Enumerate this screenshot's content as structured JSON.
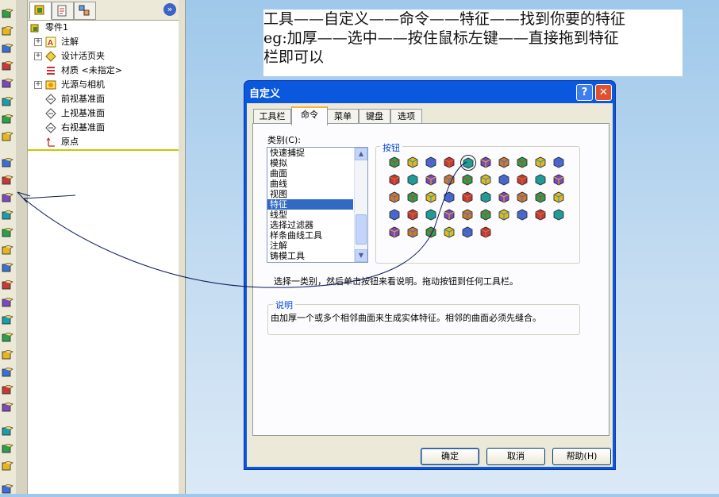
{
  "left_toolbar": {
    "icons": [
      "extrude-icon",
      "revolve-icon",
      "sweep-icon",
      "loft-icon",
      "fillet-icon",
      "chamfer-icon",
      "shell-icon",
      "draft-icon",
      "rib-icon",
      "hole-icon",
      "mirror-icon",
      "pattern-icon",
      "dome-icon",
      "wrap-icon",
      "scale-icon",
      "split-icon",
      "combine-icon",
      "thicken-icon",
      "move-face-icon",
      "freeform-icon",
      "flex-icon",
      "deform-icon",
      "indent-icon",
      "intersect-icon",
      "linear-pattern-icon",
      "circular-pattern-icon",
      "curve-pattern-icon",
      "more-icon"
    ]
  },
  "feature_manager": {
    "tabs": [
      "feature-tree-tab",
      "property-tab",
      "configuration-tab"
    ],
    "collapse_glyph": "»",
    "items": [
      {
        "label": "零件1",
        "expand": ""
      },
      {
        "label": "注解",
        "expand": "+"
      },
      {
        "label": "设计活页夹",
        "expand": "+"
      },
      {
        "label": "材质 <未指定>",
        "expand": ""
      },
      {
        "label": "光源与相机",
        "expand": "+"
      },
      {
        "label": "前视基准面",
        "expand": ""
      },
      {
        "label": "上视基准面",
        "expand": ""
      },
      {
        "label": "右视基准面",
        "expand": ""
      },
      {
        "label": "原点",
        "expand": ""
      }
    ]
  },
  "note": {
    "line1": "工具——自定义——命令——特征——找到你要的特征",
    "line2": "eg:加厚——选中——按住鼠标左键——直接拖到特征",
    "line3": "栏即可以"
  },
  "dialog": {
    "title": "自定义",
    "help_glyph": "?",
    "close_glyph": "✕",
    "tabs": [
      "工具栏",
      "命令",
      "菜单",
      "键盘",
      "选项"
    ],
    "active_tab": 1,
    "category_label": "类别(C):",
    "categories": [
      "快速捕捉",
      "模拟",
      "曲面",
      "曲线",
      "视图",
      "特征",
      "线型",
      "选择过滤器",
      "样条曲线工具",
      "注解",
      "铸模工具"
    ],
    "selected_category": 5,
    "buttons_label": "按钮",
    "hint": "选择一类别，然后单击按钮来看说明。拖动按钮到任何工具栏。",
    "description_label": "说明",
    "description": "由加厚一个或多个相邻曲面来生成实体特征。相邻的曲面必须先缝合。",
    "ok": "确定",
    "cancel": "取消",
    "help": "帮助(H)"
  },
  "colors": {
    "title_bar": "#0a58de",
    "selection": "#316ac5",
    "group_label": "#0046d5"
  }
}
